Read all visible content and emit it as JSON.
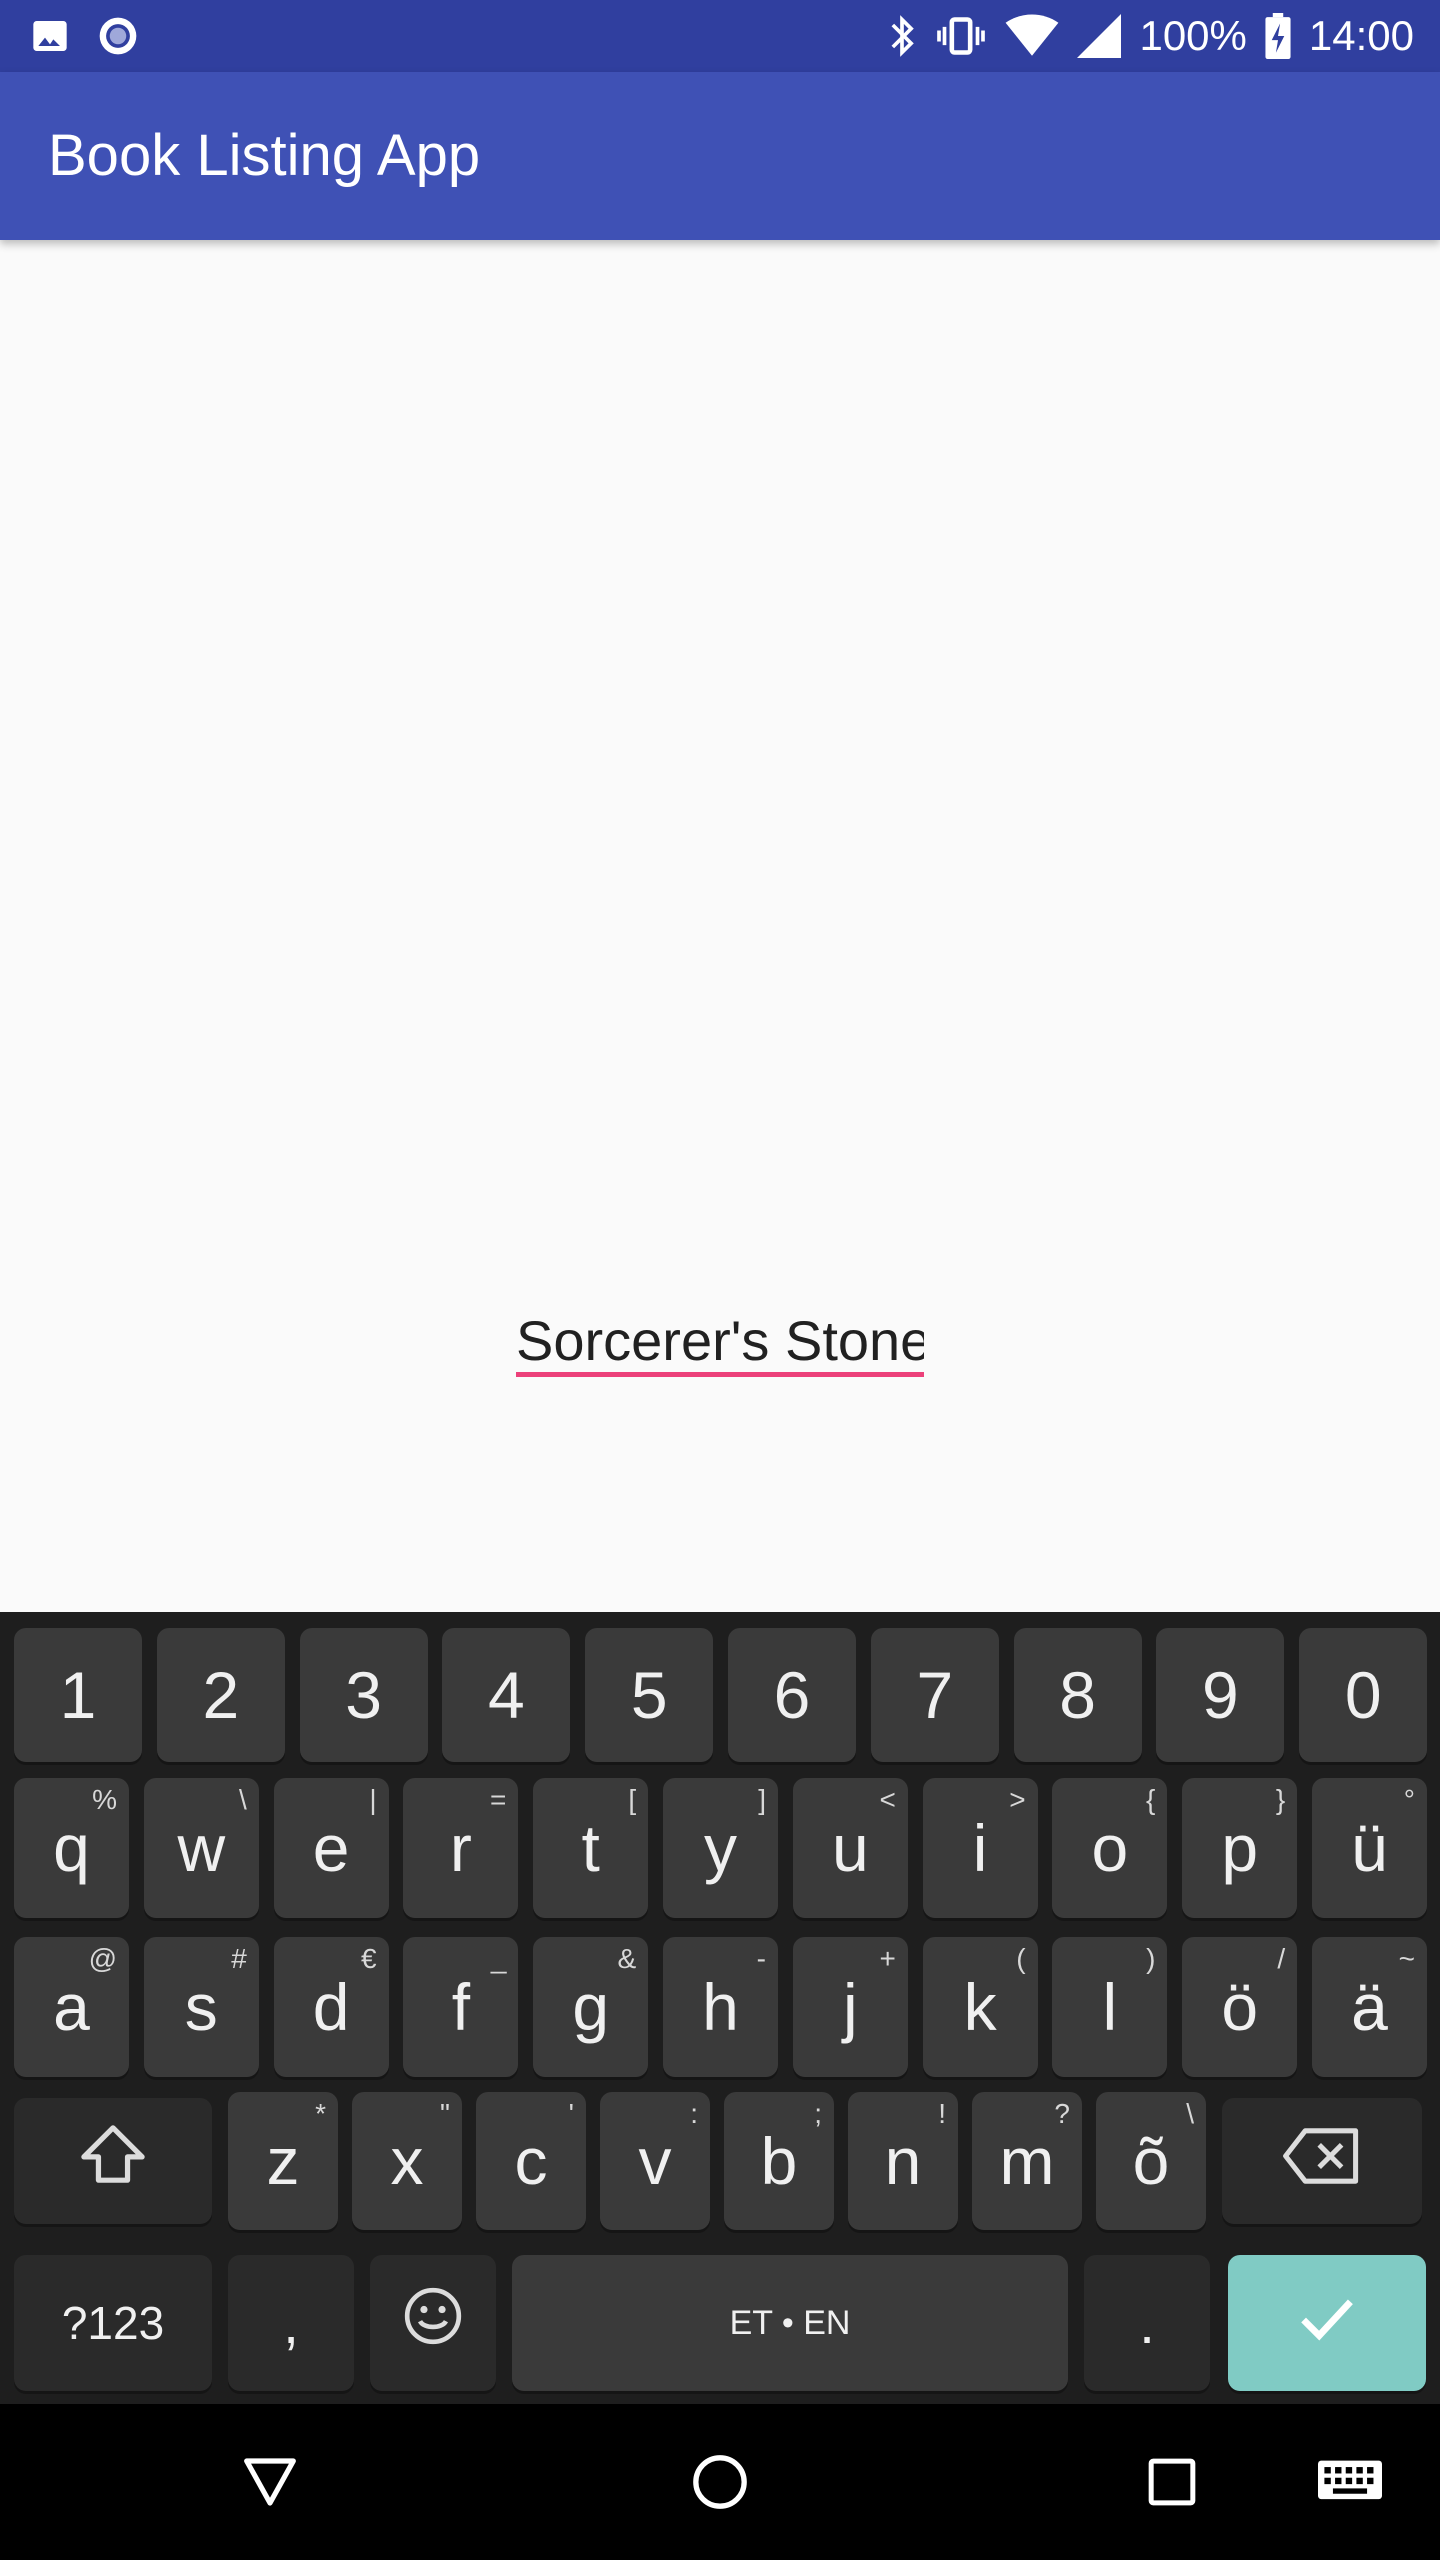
{
  "status_bar": {
    "battery": "100%",
    "time": "14:00",
    "left_icons": [
      "image-icon",
      "circle-record-icon"
    ],
    "right_icons": [
      "bluetooth-icon",
      "vibrate-icon",
      "wifi-icon",
      "signal-icon",
      "battery-icon"
    ]
  },
  "app_bar": {
    "title": "Book Listing App",
    "color": "#3f51b5",
    "status_color": "#303f9f"
  },
  "search": {
    "value": "Sorcerer's Stone",
    "underline_color": "#ec407a"
  },
  "keyboard": {
    "rows": [
      [
        {
          "k": "1"
        },
        {
          "k": "2"
        },
        {
          "k": "3"
        },
        {
          "k": "4"
        },
        {
          "k": "5"
        },
        {
          "k": "6"
        },
        {
          "k": "7"
        },
        {
          "k": "8"
        },
        {
          "k": "9"
        },
        {
          "k": "0"
        }
      ],
      [
        {
          "k": "q",
          "h": "%"
        },
        {
          "k": "w",
          "h": "\\"
        },
        {
          "k": "e",
          "h": "|"
        },
        {
          "k": "r",
          "h": "="
        },
        {
          "k": "t",
          "h": "["
        },
        {
          "k": "y",
          "h": "]"
        },
        {
          "k": "u",
          "h": "<"
        },
        {
          "k": "i",
          "h": ">"
        },
        {
          "k": "o",
          "h": "{"
        },
        {
          "k": "p",
          "h": "}"
        },
        {
          "k": "ü",
          "h": "°"
        }
      ],
      [
        {
          "k": "a",
          "h": "@"
        },
        {
          "k": "s",
          "h": "#"
        },
        {
          "k": "d",
          "h": "€"
        },
        {
          "k": "f",
          "h": "_"
        },
        {
          "k": "g",
          "h": "&"
        },
        {
          "k": "h",
          "h": "-"
        },
        {
          "k": "j",
          "h": "+"
        },
        {
          "k": "k",
          "h": "("
        },
        {
          "k": "l",
          "h": ")"
        },
        {
          "k": "ö",
          "h": "/"
        },
        {
          "k": "ä",
          "h": "~"
        }
      ],
      [
        {
          "k": "z",
          "h": "*"
        },
        {
          "k": "x",
          "h": "\""
        },
        {
          "k": "c",
          "h": "'"
        },
        {
          "k": "v",
          "h": ":"
        },
        {
          "k": "b",
          "h": ";"
        },
        {
          "k": "n",
          "h": "!"
        },
        {
          "k": "m",
          "h": "?"
        },
        {
          "k": "õ",
          "h": "\\"
        }
      ]
    ],
    "symbols_label": "?123",
    "comma_label": ",",
    "space_label": "ET • EN",
    "period_label": ".",
    "enter_color": "#80cbc4",
    "shift_icon": "shift-icon",
    "backspace_icon": "backspace-icon",
    "emoji_icon": "emoji-icon",
    "enter_icon": "checkmark-icon"
  },
  "nav_bar": {
    "icons": [
      "back-triangle-icon",
      "home-circle-icon",
      "recents-square-icon",
      "keyboard-icon"
    ]
  }
}
